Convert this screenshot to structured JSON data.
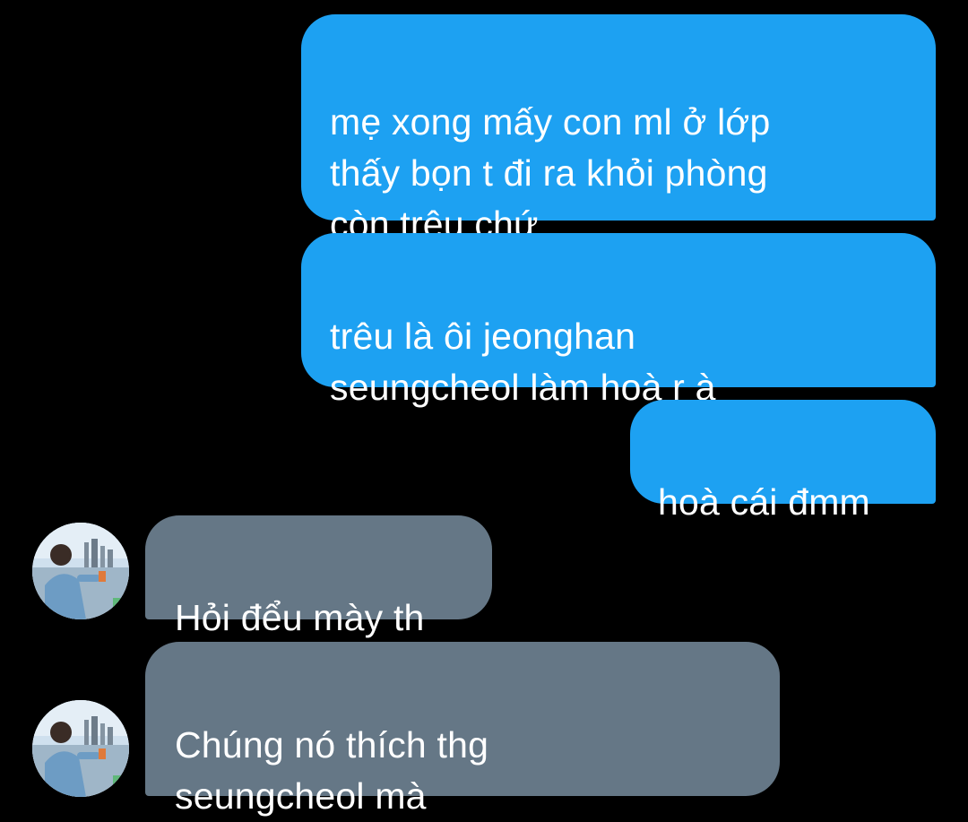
{
  "conversation": {
    "messages": [
      {
        "direction": "sent",
        "text": "mẹ xong mấy con ml ở lớp\nthấy bọn t đi ra khỏi phòng\ncòn trêu chứ"
      },
      {
        "direction": "sent",
        "text": "trêu là ôi jeonghan\nseungcheol làm hoà r à"
      },
      {
        "direction": "sent",
        "text": "hoà cái đmm"
      },
      {
        "direction": "received",
        "text": "Hỏi đểu mày th"
      },
      {
        "direction": "received",
        "text": "Chúng nó thích thg\nseungcheol mà"
      }
    ]
  },
  "colors": {
    "background": "#000000",
    "sent_bubble": "#1da1f2",
    "received_bubble": "#657786",
    "text": "#ffffff"
  },
  "icons": {
    "avatar": "contact-avatar-photo"
  }
}
